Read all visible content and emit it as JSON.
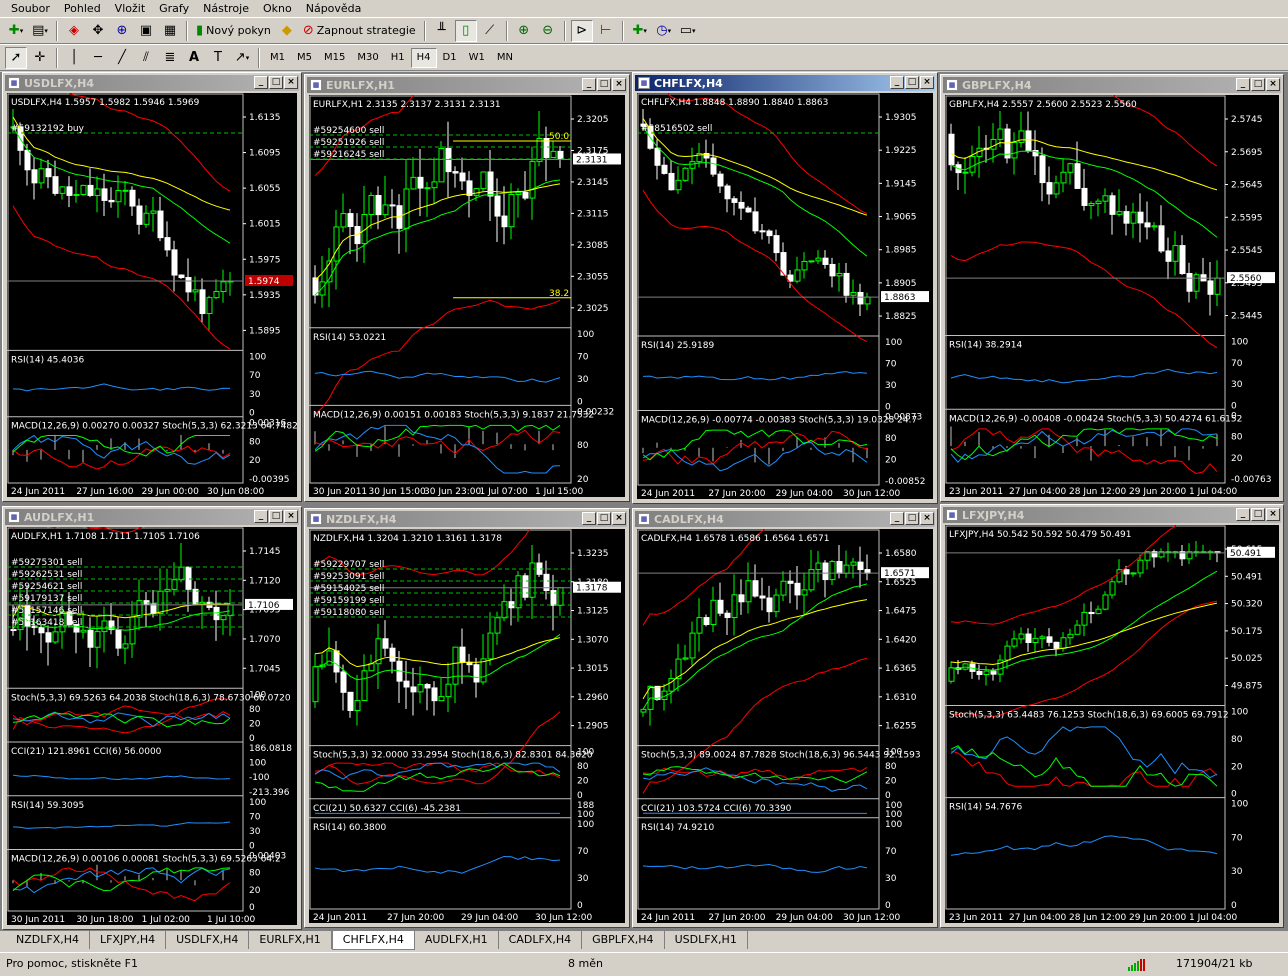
{
  "menu": [
    "Soubor",
    "Pohled",
    "Vložit",
    "Grafy",
    "Nástroje",
    "Okno",
    "Nápověda"
  ],
  "toolbar1": {
    "new_order_label": "Nový pokyn",
    "strategies_label": "Zapnout strategie"
  },
  "timeframes": [
    "M1",
    "M5",
    "M15",
    "M30",
    "H1",
    "H4",
    "D1",
    "W1",
    "MN"
  ],
  "active_timeframe": "H4",
  "colors": {
    "bg": "#000000",
    "fg": "#ffffff",
    "bull": "#00ff00",
    "bear": "#ffffff",
    "ma_red": "#ff0000",
    "ma_green": "#00ff00",
    "ma_yellow": "#ffff00",
    "osc_blue": "#1e90ff",
    "sep": "#c0c0c0"
  },
  "charts": [
    {
      "id": "usd",
      "title": "USDLFX,H4",
      "active": false,
      "header": "USDLFX,H4  1.5957 1.5982 1.5946 1.5969",
      "prices": [
        "1.6135",
        "1.6095",
        "1.6055",
        "1.6015",
        "1.5975",
        "1.5935",
        "1.5895"
      ],
      "current_price": "1.5974",
      "trend": "down",
      "labels": [
        "#59132192 buy"
      ],
      "panes": [
        {
          "label": "RSI(14) 45.4036",
          "levels": [
            "100",
            "70",
            "30",
            "0"
          ]
        },
        {
          "label": "MACD(12,26,9) 0.00270 0.00327  Stoch(5,3,3) 62.3213 64.7482",
          "levels": [
            "0.00316",
            "80",
            "20",
            "-0.00395"
          ]
        }
      ],
      "dates": [
        "24 Jun 2011",
        "27 Jun 16:00",
        "29 Jun 00:00",
        "30 Jun 08:00"
      ]
    },
    {
      "id": "eur",
      "title": "EURLFX,H1",
      "active": false,
      "header": "EURLFX,H1  2.3135 2.3137 2.3131 2.3131",
      "prices": [
        "2.3205",
        "2.3175",
        "2.3145",
        "2.3115",
        "2.3085",
        "2.3055",
        "2.3025"
      ],
      "current_price": "2.3131",
      "trend": "up",
      "labels": [
        "#59254600 sell",
        "#59251926 sell",
        "#59216245 sell"
      ],
      "fib": [
        "50.0",
        "38.2"
      ],
      "panes": [
        {
          "label": "RSI(14) 53.0221",
          "levels": [
            "100",
            "70",
            "30",
            "0"
          ]
        },
        {
          "label": "MACD(12,26,9) 0.00151 0.00183  Stoch(5,3,3) 9.1837 21.7532",
          "levels": [
            "0.00232",
            "80",
            "20"
          ]
        }
      ],
      "dates": [
        "30 Jun 2011",
        "30 Jun 15:00",
        "30 Jun 23:00",
        "1 Jul 07:00",
        "1 Jul 15:00"
      ]
    },
    {
      "id": "chf",
      "title": "CHFLFX,H4",
      "active": true,
      "header": "CHFLFX,H4  1.8848 1.8890 1.8840 1.8863",
      "prices": [
        "1.9305",
        "1.9225",
        "1.9145",
        "1.9065",
        "1.8985",
        "1.8905",
        "1.8825"
      ],
      "current_price": "1.8863",
      "trend": "down",
      "labels": [
        "#58516502 sell"
      ],
      "panes": [
        {
          "label": "RSI(14) 25.9189",
          "levels": [
            "100",
            "70",
            "30",
            "0"
          ]
        },
        {
          "label": "MACD(12,26,9) -0.00774 -0.00383  Stoch(5,3,3) 19.0328 24.7",
          "levels": [
            "0.00873",
            "80",
            "20",
            "-0.00852"
          ]
        }
      ],
      "dates": [
        "24 Jun 2011",
        "27 Jun 20:00",
        "29 Jun 04:00",
        "30 Jun 12:00"
      ]
    },
    {
      "id": "gbp",
      "title": "GBPLFX,H4",
      "active": false,
      "header": "GBPLFX,H4  2.5557 2.5600 2.5523 2.5560",
      "prices": [
        "2.5745",
        "2.5695",
        "2.5645",
        "2.5595",
        "2.5545",
        "2.5495",
        "2.5445"
      ],
      "current_price": "2.5560",
      "trend": "down",
      "labels": [],
      "panes": [
        {
          "label": "RSI(14) 38.2914",
          "levels": [
            "100",
            "70",
            "30",
            "0"
          ]
        },
        {
          "label": "MACD(12,26,9) -0.00408 -0.00424  Stoch(5,3,3) 50.4274 61.6152",
          "levels": [
            "0",
            "80",
            "20",
            "-0.00763"
          ]
        }
      ],
      "dates": [
        "23 Jun 2011",
        "27 Jun 04:00",
        "28 Jun 12:00",
        "29 Jun 20:00",
        "1 Jul 04:00"
      ]
    },
    {
      "id": "aud",
      "title": "AUDLFX,H1",
      "active": false,
      "header": "AUDLFX,H1  1.7108 1.7111 1.7105 1.7106",
      "prices": [
        "1.7145",
        "1.7120",
        "1.7095",
        "1.7070",
        "1.7045"
      ],
      "current_price": "1.7106",
      "trend": "flat",
      "labels": [
        "#59275301 sell",
        "#59262531 sell",
        "#59254621 sell",
        "#59179137 sell",
        "#59157146 sell",
        "#59163418 sell"
      ],
      "panes": [
        {
          "label": "Stoch(5,3,3) 69.5263 64.2038  Stoch(18,6,3) 78.6730 66.0720",
          "levels": [
            "100",
            "80",
            "20",
            "0"
          ]
        },
        {
          "label": "CCI(21) 121.8961  CCI(6) 56.0000",
          "levels": [
            "186.0818",
            "100",
            "-100",
            "-213.396"
          ]
        },
        {
          "label": "RSI(14) 59.3095",
          "levels": [
            "100",
            "70",
            "30",
            "0"
          ]
        },
        {
          "label": "MACD(12,26,9) 0.00106 0.00081  Stoch(5,3,3) 69.5263 64.2",
          "levels": [
            "0.00403",
            "80",
            "20",
            "0"
          ]
        }
      ],
      "dates": [
        "30 Jun 2011",
        "30 Jun 18:00",
        "1 Jul 02:00",
        "1 Jul 10:00"
      ]
    },
    {
      "id": "nzd",
      "title": "NZDLFX,H4",
      "active": false,
      "header": "NZDLFX,H4  1.3204 1.3210 1.3161 1.3178",
      "prices": [
        "1.3235",
        "1.3180",
        "1.3125",
        "1.3070",
        "1.3015",
        "1.2960",
        "1.2905"
      ],
      "current_price": "1.3178",
      "trend": "up",
      "labels": [
        "#59229707 sell",
        "#59253091 sell",
        "#59154025 sell",
        "#59159199 sell",
        "#59118080 sell"
      ],
      "panes": [
        {
          "label": "Stoch(5,3,3) 32.0000 33.2954  Stoch(18,6,3) 82.8301 84.3620",
          "levels": [
            "100",
            "80",
            "20",
            "0"
          ]
        },
        {
          "label": "CCI(21) 50.6327  CCI(6) -45.2381",
          "levels": [
            "188",
            "100"
          ]
        },
        {
          "label": "RSI(14) 60.3800",
          "levels": [
            "100",
            "70",
            "30",
            "0"
          ]
        }
      ],
      "dates": [
        "24 Jun 2011",
        "27 Jun 20:00",
        "29 Jun 04:00",
        "30 Jun 12:00"
      ]
    },
    {
      "id": "cad",
      "title": "CADLFX,H4",
      "active": false,
      "header": "CADLFX,H4  1.6578 1.6586 1.6564 1.6571",
      "prices": [
        "1.6580",
        "1.6525",
        "1.6475",
        "1.6420",
        "1.6365",
        "1.6310",
        "1.6255"
      ],
      "current_price": "1.6571",
      "trend": "up",
      "labels": [],
      "panes": [
        {
          "label": "Stoch(5,3,3) 89.0024 87.7828  Stoch(18,6,3) 96.5443 92.1593",
          "levels": [
            "100",
            "80",
            "20",
            "0"
          ]
        },
        {
          "label": "CCI(21) 103.5724  CCI(6) 70.3390",
          "levels": [
            "100",
            "100"
          ]
        },
        {
          "label": "RSI(14) 74.9210",
          "levels": [
            "100",
            "70",
            "30",
            "0"
          ]
        }
      ],
      "dates": [
        "24 Jun 2011",
        "27 Jun 20:00",
        "29 Jun 04:00",
        "30 Jun 12:00"
      ]
    },
    {
      "id": "jpy",
      "title": "LFXJPY,H4",
      "active": false,
      "header": "LFXJPY,H4  50.542 50.592 50.479 50.491",
      "prices": [
        "50.615",
        "50.491",
        "50.320",
        "50.175",
        "50.025",
        "49.875"
      ],
      "current_price": "50.491",
      "trend": "up",
      "labels": [],
      "panes": [
        {
          "label": "Stoch(5,3,3) 63.4483 76.1253  Stoch(18,6,3) 69.6005 69.7912",
          "levels": [
            "100",
            "80",
            "20",
            "0"
          ]
        },
        {
          "label": "RSI(14) 54.7676",
          "levels": [
            "100",
            "70",
            "30",
            "0"
          ]
        }
      ],
      "dates": [
        "23 Jun 2011",
        "27 Jun 04:00",
        "28 Jun 12:00",
        "29 Jun 20:00",
        "1 Jul 04:00"
      ]
    }
  ],
  "tabs": [
    "NZDLFX,H4",
    "LFXJPY,H4",
    "USDLFX,H4",
    "EURLFX,H1",
    "CHFLFX,H4",
    "AUDLFX,H1",
    "CADLFX,H4",
    "GBPLFX,H4",
    "USDLFX,H1"
  ],
  "active_tab": "CHFLFX,H4",
  "status": {
    "help": "Pro pomoc, stiskněte F1",
    "profile": "8 měn",
    "traffic": "171904/21 kb"
  }
}
